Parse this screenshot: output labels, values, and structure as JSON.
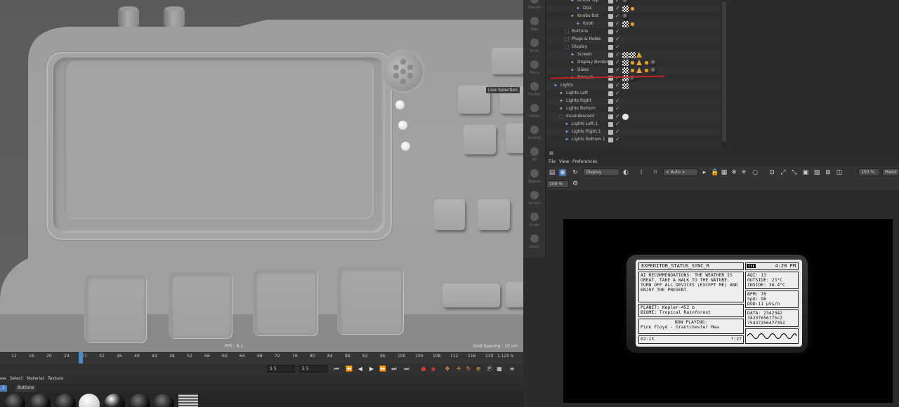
{
  "viewport": {
    "live_selection": "Live Selection",
    "fps": "FPS : 6.1",
    "grid_spacing": "Grid Spacing : 10 cm"
  },
  "timeline": {
    "ticks": [
      "12",
      "16",
      "20",
      "24",
      "27",
      "32",
      "36",
      "40",
      "44",
      "48",
      "52",
      "56",
      "60",
      "64",
      "68",
      "72",
      "76",
      "80",
      "84",
      "88",
      "92",
      "96",
      "100",
      "104",
      "108",
      "112",
      "116",
      "120"
    ],
    "right_value": "1.125 S",
    "field_left": "5 5",
    "field_right": "5 5"
  },
  "material_menu": [
    "ew",
    "Select",
    "Material",
    "Texture"
  ],
  "material_tabs": [
    "2",
    "Buttons"
  ],
  "tools": [
    "Smooth",
    "Wax",
    "Knife",
    "Pinch",
    "Flatten",
    "Inflate",
    "Amplify",
    "Fill",
    "Repeat",
    "Scrape",
    "Erase",
    "Select"
  ],
  "objects": [
    {
      "name": "Knobs Top",
      "indent": 3
    },
    {
      "name": "Disc",
      "indent": 4
    },
    {
      "name": "Knobs Bot",
      "indent": 3
    },
    {
      "name": "Knob",
      "indent": 4
    },
    {
      "name": "Buttons",
      "indent": 2
    },
    {
      "name": "Plugs & Holes",
      "indent": 2
    },
    {
      "name": "Display",
      "indent": 2
    },
    {
      "name": "Screen",
      "indent": 3
    },
    {
      "name": "Display Border",
      "indent": 3
    },
    {
      "name": "Glass",
      "indent": 3
    },
    {
      "name": "Dimarik",
      "indent": 3
    },
    {
      "name": "Lights",
      "indent": 0
    },
    {
      "name": "Lights Left",
      "indent": 1
    },
    {
      "name": "Lights Right",
      "indent": 1
    },
    {
      "name": "Lights Bottom",
      "indent": 1
    },
    {
      "name": "Incandescent",
      "indent": 1
    },
    {
      "name": "Lights Left.1",
      "indent": 2
    },
    {
      "name": "Lights Right.1",
      "indent": 2
    },
    {
      "name": "Lights Bottom.1",
      "indent": 2
    }
  ],
  "picture_viewer": {
    "menu": [
      "File",
      "View",
      "Preferences"
    ],
    "display_dropdown": "Display",
    "auto_dropdown": "< Auto >",
    "zoom": "100 %",
    "zoom_left": "100 %",
    "fixed_label": "Fixed Si"
  },
  "lcd": {
    "title": "EXPEDITOR_STATUS_SYNC_R",
    "time": "4:20 PM",
    "ai_text": "AI RECOMMENDATIONS: THE WEATHER IS GREAT. TAKE A WALK TO THE NATURE. TURN OFF ALL DEVICES (EXCEPT ME) AND ENJOY THE PRESENT.",
    "planet": "PLANET: Kepler-452 b",
    "biome": "BIOME: Tropical Rainforest",
    "now_playing_label": "NOW PLAYING:",
    "track": "Pink Floyd - Grantchester Mea",
    "elapsed": "02:15",
    "duration": "7:27",
    "aqi": "AQI: 13",
    "outside": "OUTSIDE: 23°C",
    "inside": "INSIDE: 36.4°C",
    "bpm": "BPM: 78",
    "spo2": "SpO: 98",
    "dose": "DOD:11 μVs/h",
    "data_label": "DATA: 2342342",
    "data_line2": "34237656775c2",
    "data_line3": "75437256477352"
  }
}
